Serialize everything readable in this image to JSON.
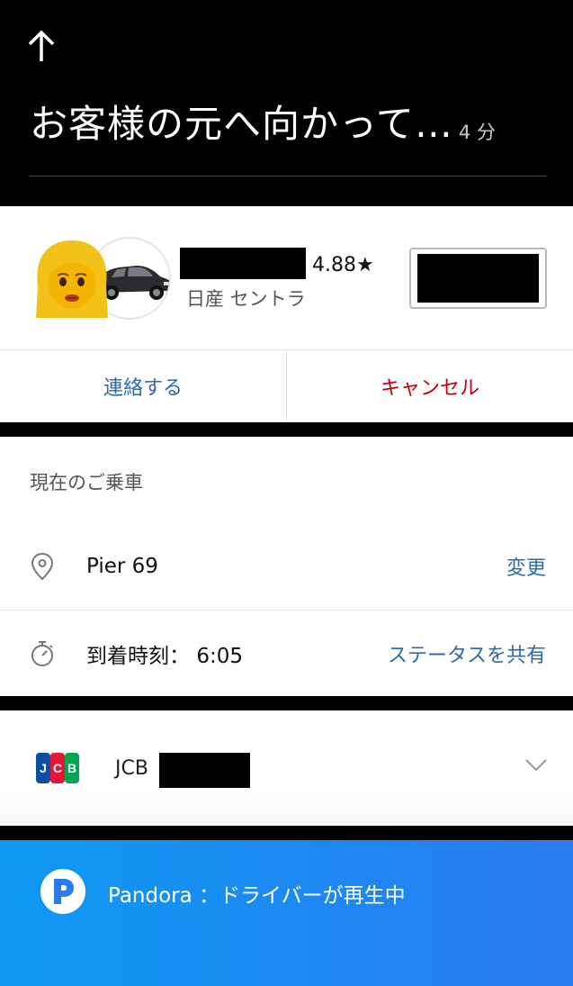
{
  "header": {
    "title": "お客様の元へ向かって…",
    "eta": "4 分"
  },
  "driver": {
    "rating": "4.88★",
    "car_model": "日産 セントラ"
  },
  "actions": {
    "contact_label": "連絡する",
    "cancel_label": "キャンセル"
  },
  "trip": {
    "section_label": "現在のご乗車",
    "pickup_location": "Pier 69",
    "change_label": "変更",
    "arrival_label": "到着時刻：",
    "arrival_time": "6:05",
    "share_status_label": "ステータスを共有"
  },
  "payment": {
    "card_brand": "JCB"
  },
  "music": {
    "service": "Pandora",
    "status": "：ドライバーが再生中"
  },
  "colors": {
    "link_blue": "#2e6aa8",
    "cancel_red": "#c4000b",
    "pandora_blue": "#0d99f2"
  }
}
